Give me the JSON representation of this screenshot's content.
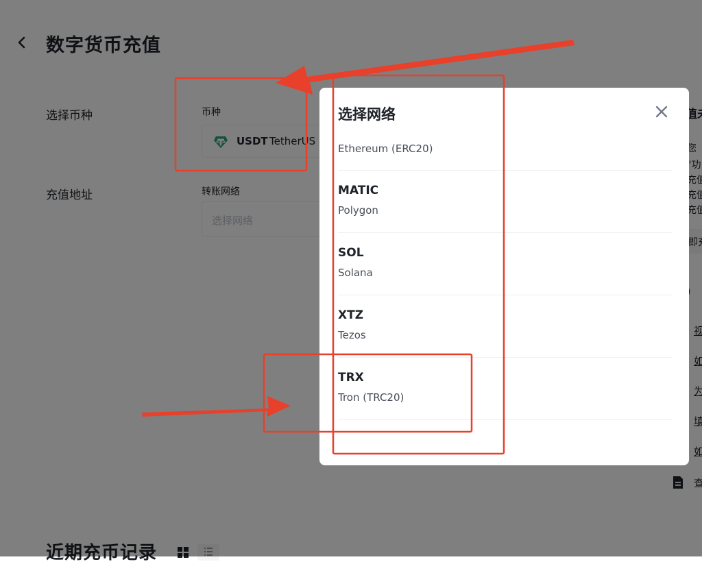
{
  "header": {
    "title": "数字货币充值",
    "back_icon": "chevron-left-icon"
  },
  "coin_row": {
    "label": "选择币种",
    "field_label": "币种",
    "selected_symbol": "USDT",
    "selected_name": "TetherUS",
    "icon": "tether-icon"
  },
  "address_row": {
    "label": "充值地址",
    "field_label": "转账网络",
    "placeholder": "选择网络"
  },
  "side_panel": {
    "title_fragment": "值未",
    "text_fragments": [
      "您",
      "\"功",
      "充值",
      "充值",
      "充值"
    ],
    "box_fragment": "即充",
    "section_fragment": ")",
    "faq_fragments": [
      "视",
      "如",
      "为",
      "填",
      "如"
    ],
    "doc_fragment": "查"
  },
  "history": {
    "title": "近期充币记录",
    "grid_icon": "grid-view-icon",
    "list_icon": "list-view-icon"
  },
  "modal": {
    "title": "选择网络",
    "close_icon": "close-icon",
    "networks": [
      {
        "symbol": "",
        "name": "Ethereum (ERC20)"
      },
      {
        "symbol": "MATIC",
        "name": "Polygon"
      },
      {
        "symbol": "SOL",
        "name": "Solana"
      },
      {
        "symbol": "XTZ",
        "name": "Tezos"
      },
      {
        "symbol": "TRX",
        "name": "Tron (TRC20)"
      }
    ]
  },
  "colors": {
    "overlay": "#000000",
    "annotation_red": "#e8402a",
    "tether_green": "#26a17b",
    "text_primary": "#1e2329",
    "text_secondary": "#474d57",
    "placeholder": "#b7bdc6"
  }
}
